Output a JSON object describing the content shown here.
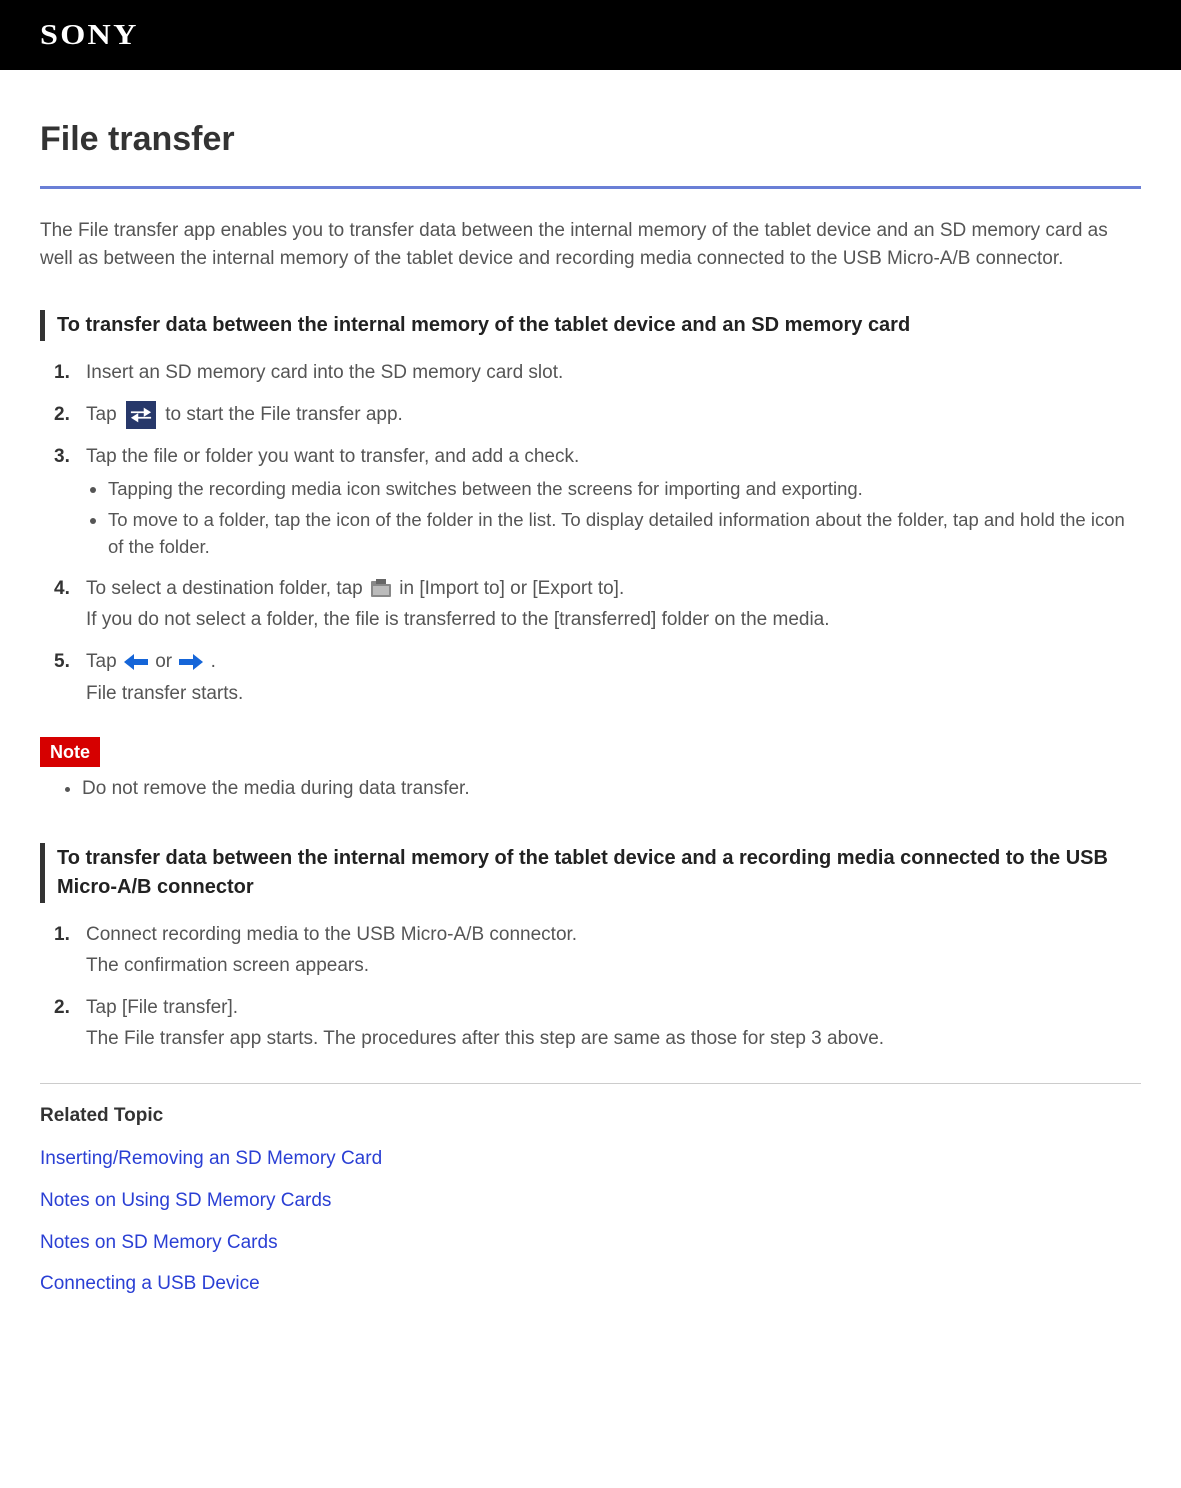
{
  "brand": "SONY",
  "page_title": "File transfer",
  "intro": "The File transfer app enables you to transfer data between the internal memory of the tablet device and an SD memory card as well as between the internal memory of the tablet device and recording media connected to the USB Micro-A/B connector.",
  "section_sd": {
    "heading": "To transfer data between the internal memory of the tablet device and an SD memory card",
    "step1": "Insert an SD memory card into the SD memory card slot.",
    "step2_a": "Tap ",
    "step2_b": " to start the File transfer app.",
    "step3": "Tap the file or folder you want to transfer, and add a check.",
    "step3_b1": "Tapping the recording media icon switches between the screens for importing and exporting.",
    "step3_b2": "To move to a folder, tap the icon of the folder in the list. To display detailed information about the folder, tap and hold the icon of the folder.",
    "step4_a": "To select a destination folder, tap ",
    "step4_b": " in [Import to] or [Export to].",
    "step4_sub": "If you do not select a folder, the file is transferred to the [transferred] folder on the media.",
    "step5_a": "Tap ",
    "step5_or": " or ",
    "step5_b": ".",
    "step5_sub": "File transfer starts."
  },
  "note_label": "Note",
  "note_item": "Do not remove the media during data transfer.",
  "section_usb": {
    "heading": "To transfer data between the internal memory of the tablet device and a recording media connected to the USB Micro-A/B connector",
    "step1": "Connect recording media to the USB Micro-A/B connector.",
    "step1_sub": "The confirmation screen appears.",
    "step2": "Tap [File transfer].",
    "step2_sub": "The File transfer app starts. The procedures after this step are same as those for step 3 above."
  },
  "related_heading": "Related Topic",
  "related_links": {
    "l1": "Inserting/Removing an SD Memory Card",
    "l2": "Notes on Using SD Memory Cards",
    "l3": "Notes on SD Memory Cards",
    "l4": "Connecting a USB Device"
  }
}
